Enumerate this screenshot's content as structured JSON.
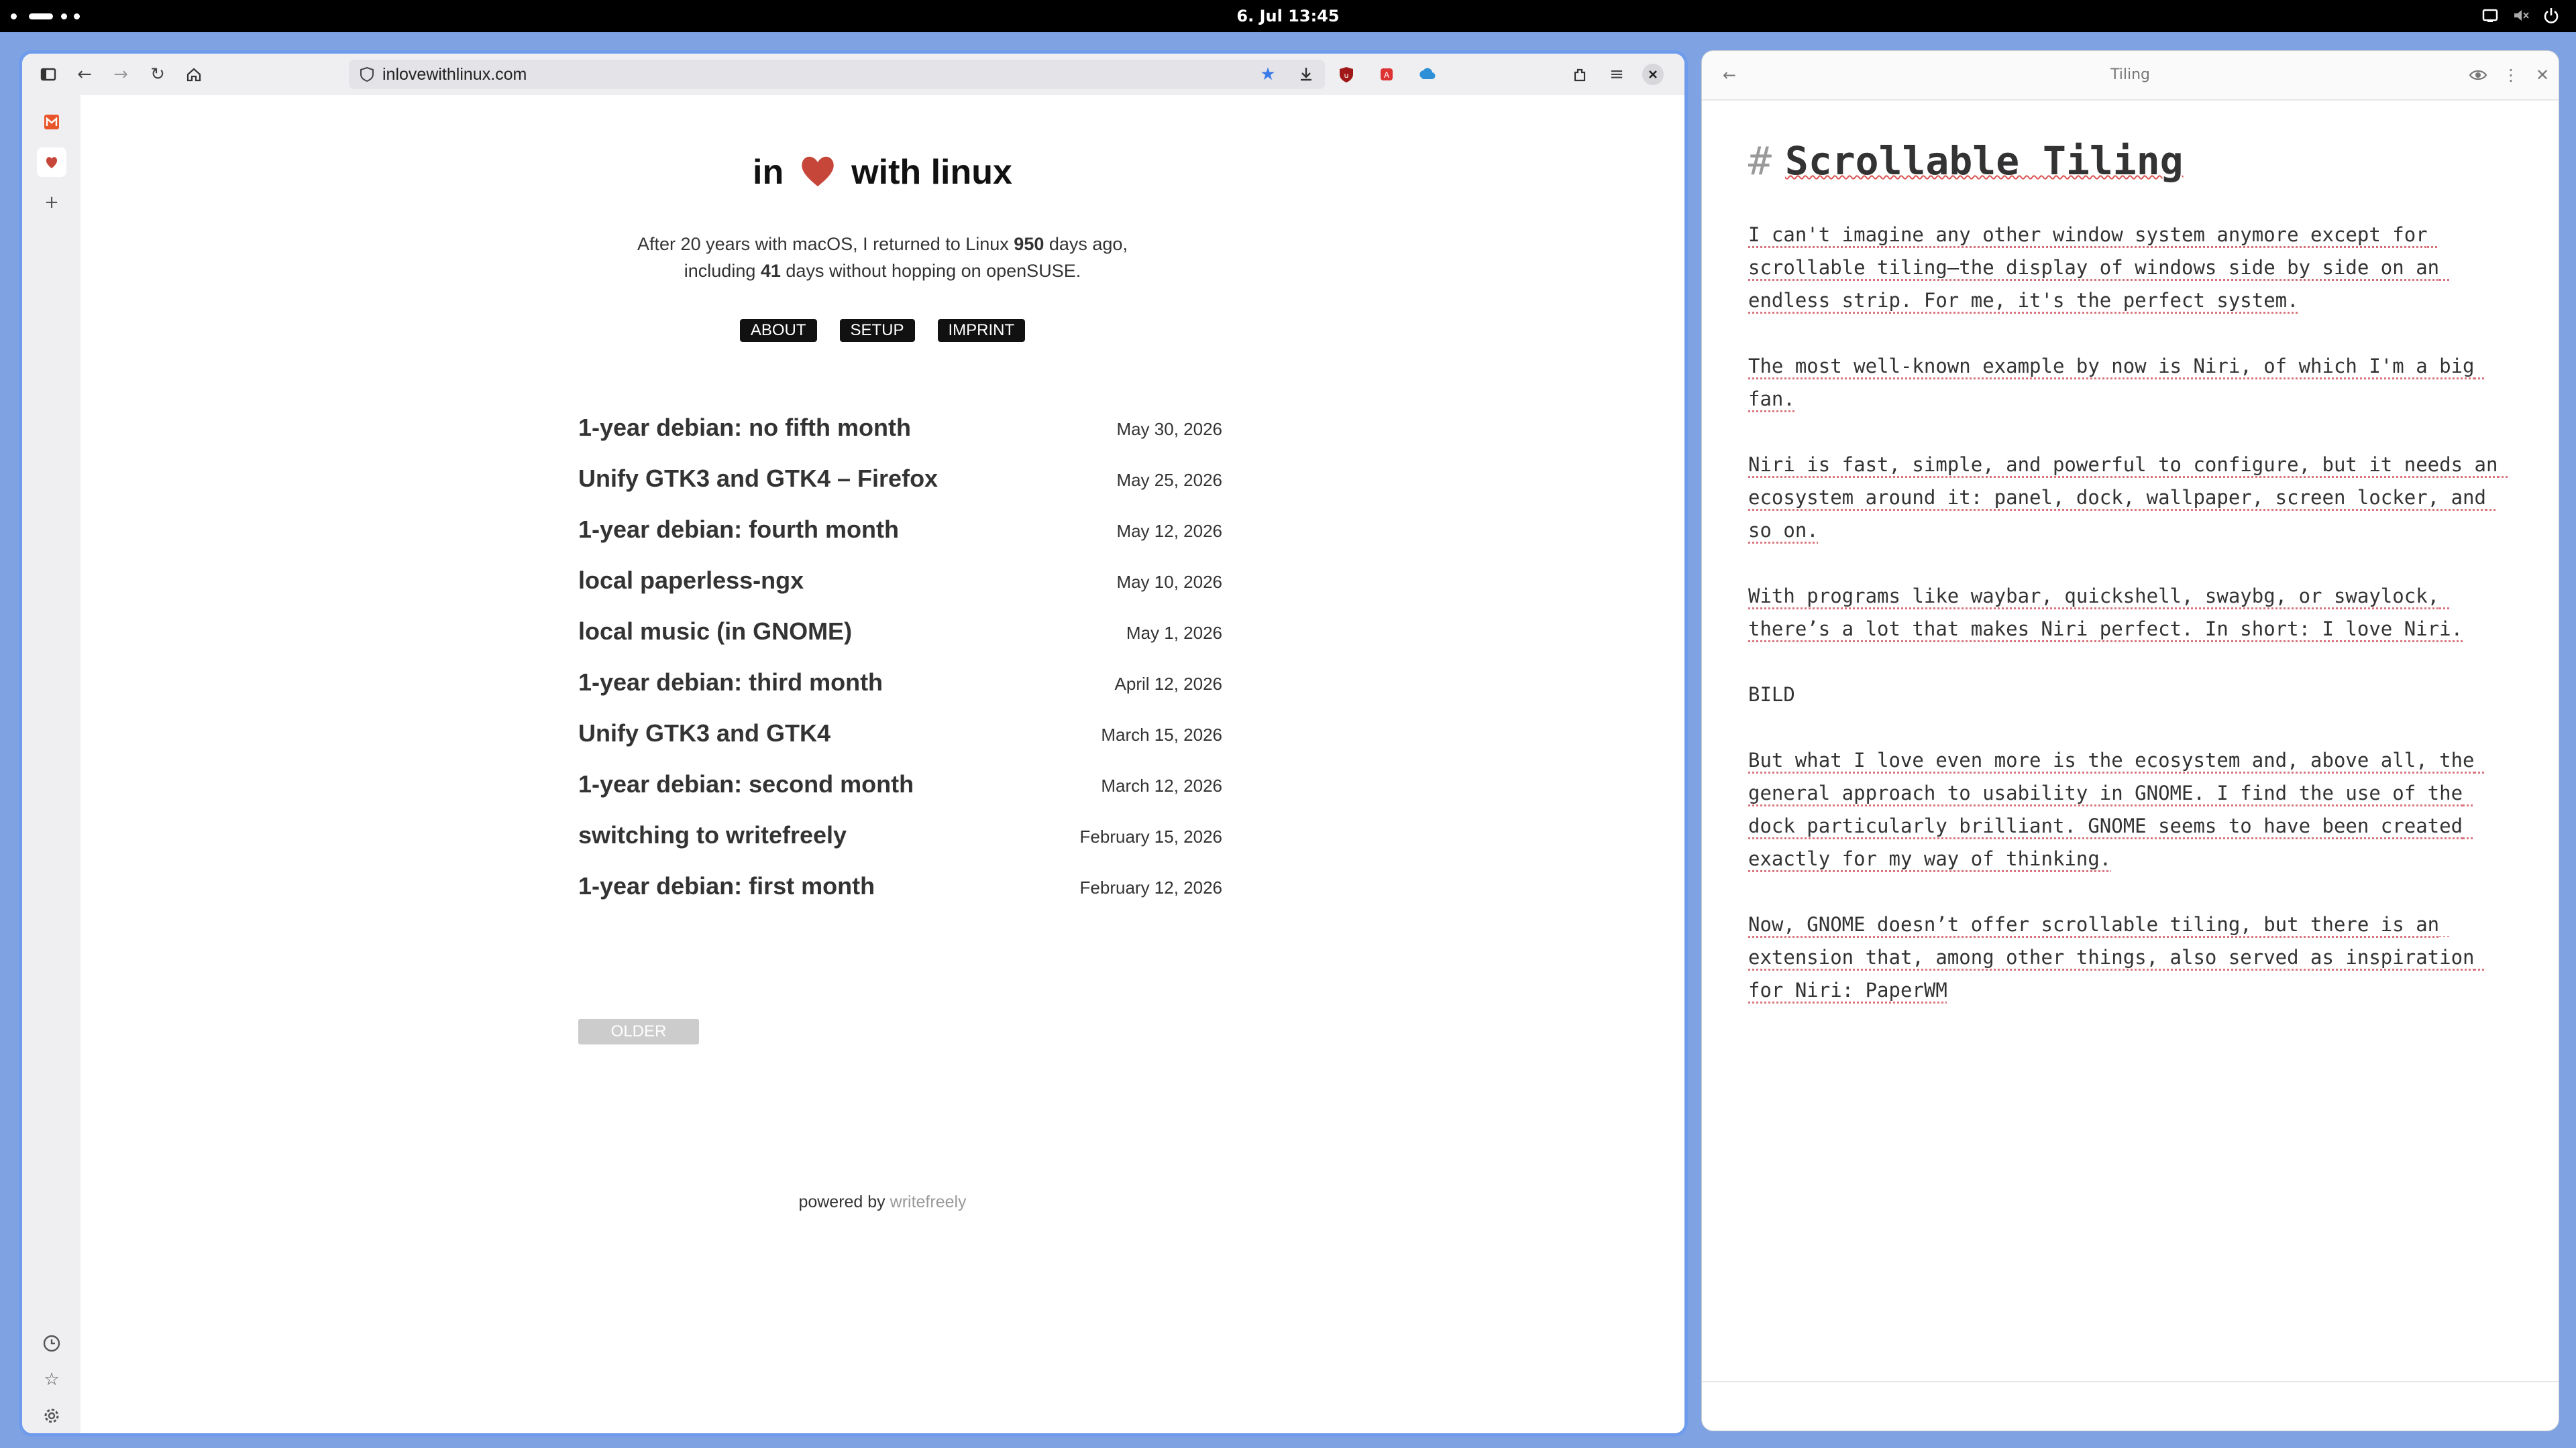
{
  "system": {
    "clock": "6. Jul  13:45"
  },
  "browser": {
    "url": "inlovewithlinux.com",
    "icons": [
      "sidebar-toggle-icon",
      "back-icon",
      "forward-icon",
      "reload-icon",
      "home-icon",
      "shield-icon",
      "bookmark-star-icon",
      "download-icon",
      "ublock-icon",
      "extension-icon",
      "sync-icon",
      "extensions-icon",
      "menu-icon",
      "close-icon"
    ],
    "sidebar_icons": [
      "mail-app-icon",
      "heart-app-icon",
      "add-icon",
      "history-icon",
      "bookmarks-icon",
      "settings-icon"
    ]
  },
  "site": {
    "title_pre": "in",
    "title_post": "with linux",
    "intro": {
      "line1_a": "After 20 years with macOS, I returned to Linux ",
      "days": "950",
      "line1_b": " days ago,",
      "line2_a": "including ",
      "days_no_hop": "41",
      "line2_b": " days without hopping on openSUSE."
    },
    "nav": [
      "ABOUT",
      "SETUP",
      "IMPRINT"
    ],
    "posts": [
      {
        "title": "1-year debian: no fifth month",
        "date": "May 30, 2026"
      },
      {
        "title": "Unify GTK3 and GTK4 – Firefox",
        "date": "May 25, 2026"
      },
      {
        "title": "1-year debian: fourth month",
        "date": "May 12, 2026"
      },
      {
        "title": "local paperless-ngx",
        "date": "May 10, 2026"
      },
      {
        "title": "local music (in GNOME)",
        "date": "May 1, 2026"
      },
      {
        "title": "1-year debian: third month",
        "date": "April 12, 2026"
      },
      {
        "title": "Unify GTK3 and GTK4",
        "date": "March 15, 2026"
      },
      {
        "title": "1-year debian: second month",
        "date": "March 12, 2026"
      },
      {
        "title": "switching to writefreely",
        "date": "February 15, 2026"
      },
      {
        "title": "1-year debian: first month",
        "date": "February 12, 2026"
      }
    ],
    "older": "OLDER",
    "footer_prefix": "powered by ",
    "footer_link": "writefreely",
    "heart_color": "#c7463a"
  },
  "editor": {
    "window_title": "Tiling",
    "heading_hash": "#",
    "heading": "Scrollable Tiling",
    "paragraphs": [
      "I can't imagine any other window system anymore except for scrollable tiling—the display of windows side by side on an endless strip. For me, it's the perfect system.",
      "The most well-known example by now is Niri, of which I'm a big fan.",
      "Niri is fast, simple, and powerful to configure, but it needs an ecosystem around it: panel, dock, wallpaper, screen locker, and so on.",
      "With programs like waybar, quickshell, swaybg, or swaylock, there’s a lot that makes Niri perfect. In short: I love Niri.",
      "BILD",
      "But what I love even more is the ecosystem and, above all, the general approach to usability in GNOME. I find the use of the dock particularly brilliant. GNOME seems to have been created exactly for my way of thinking.",
      "Now, GNOME doesn’t offer scrollable tiling, but there is an extension that, among other things, also served as inspiration for Niri: PaperWM"
    ]
  }
}
